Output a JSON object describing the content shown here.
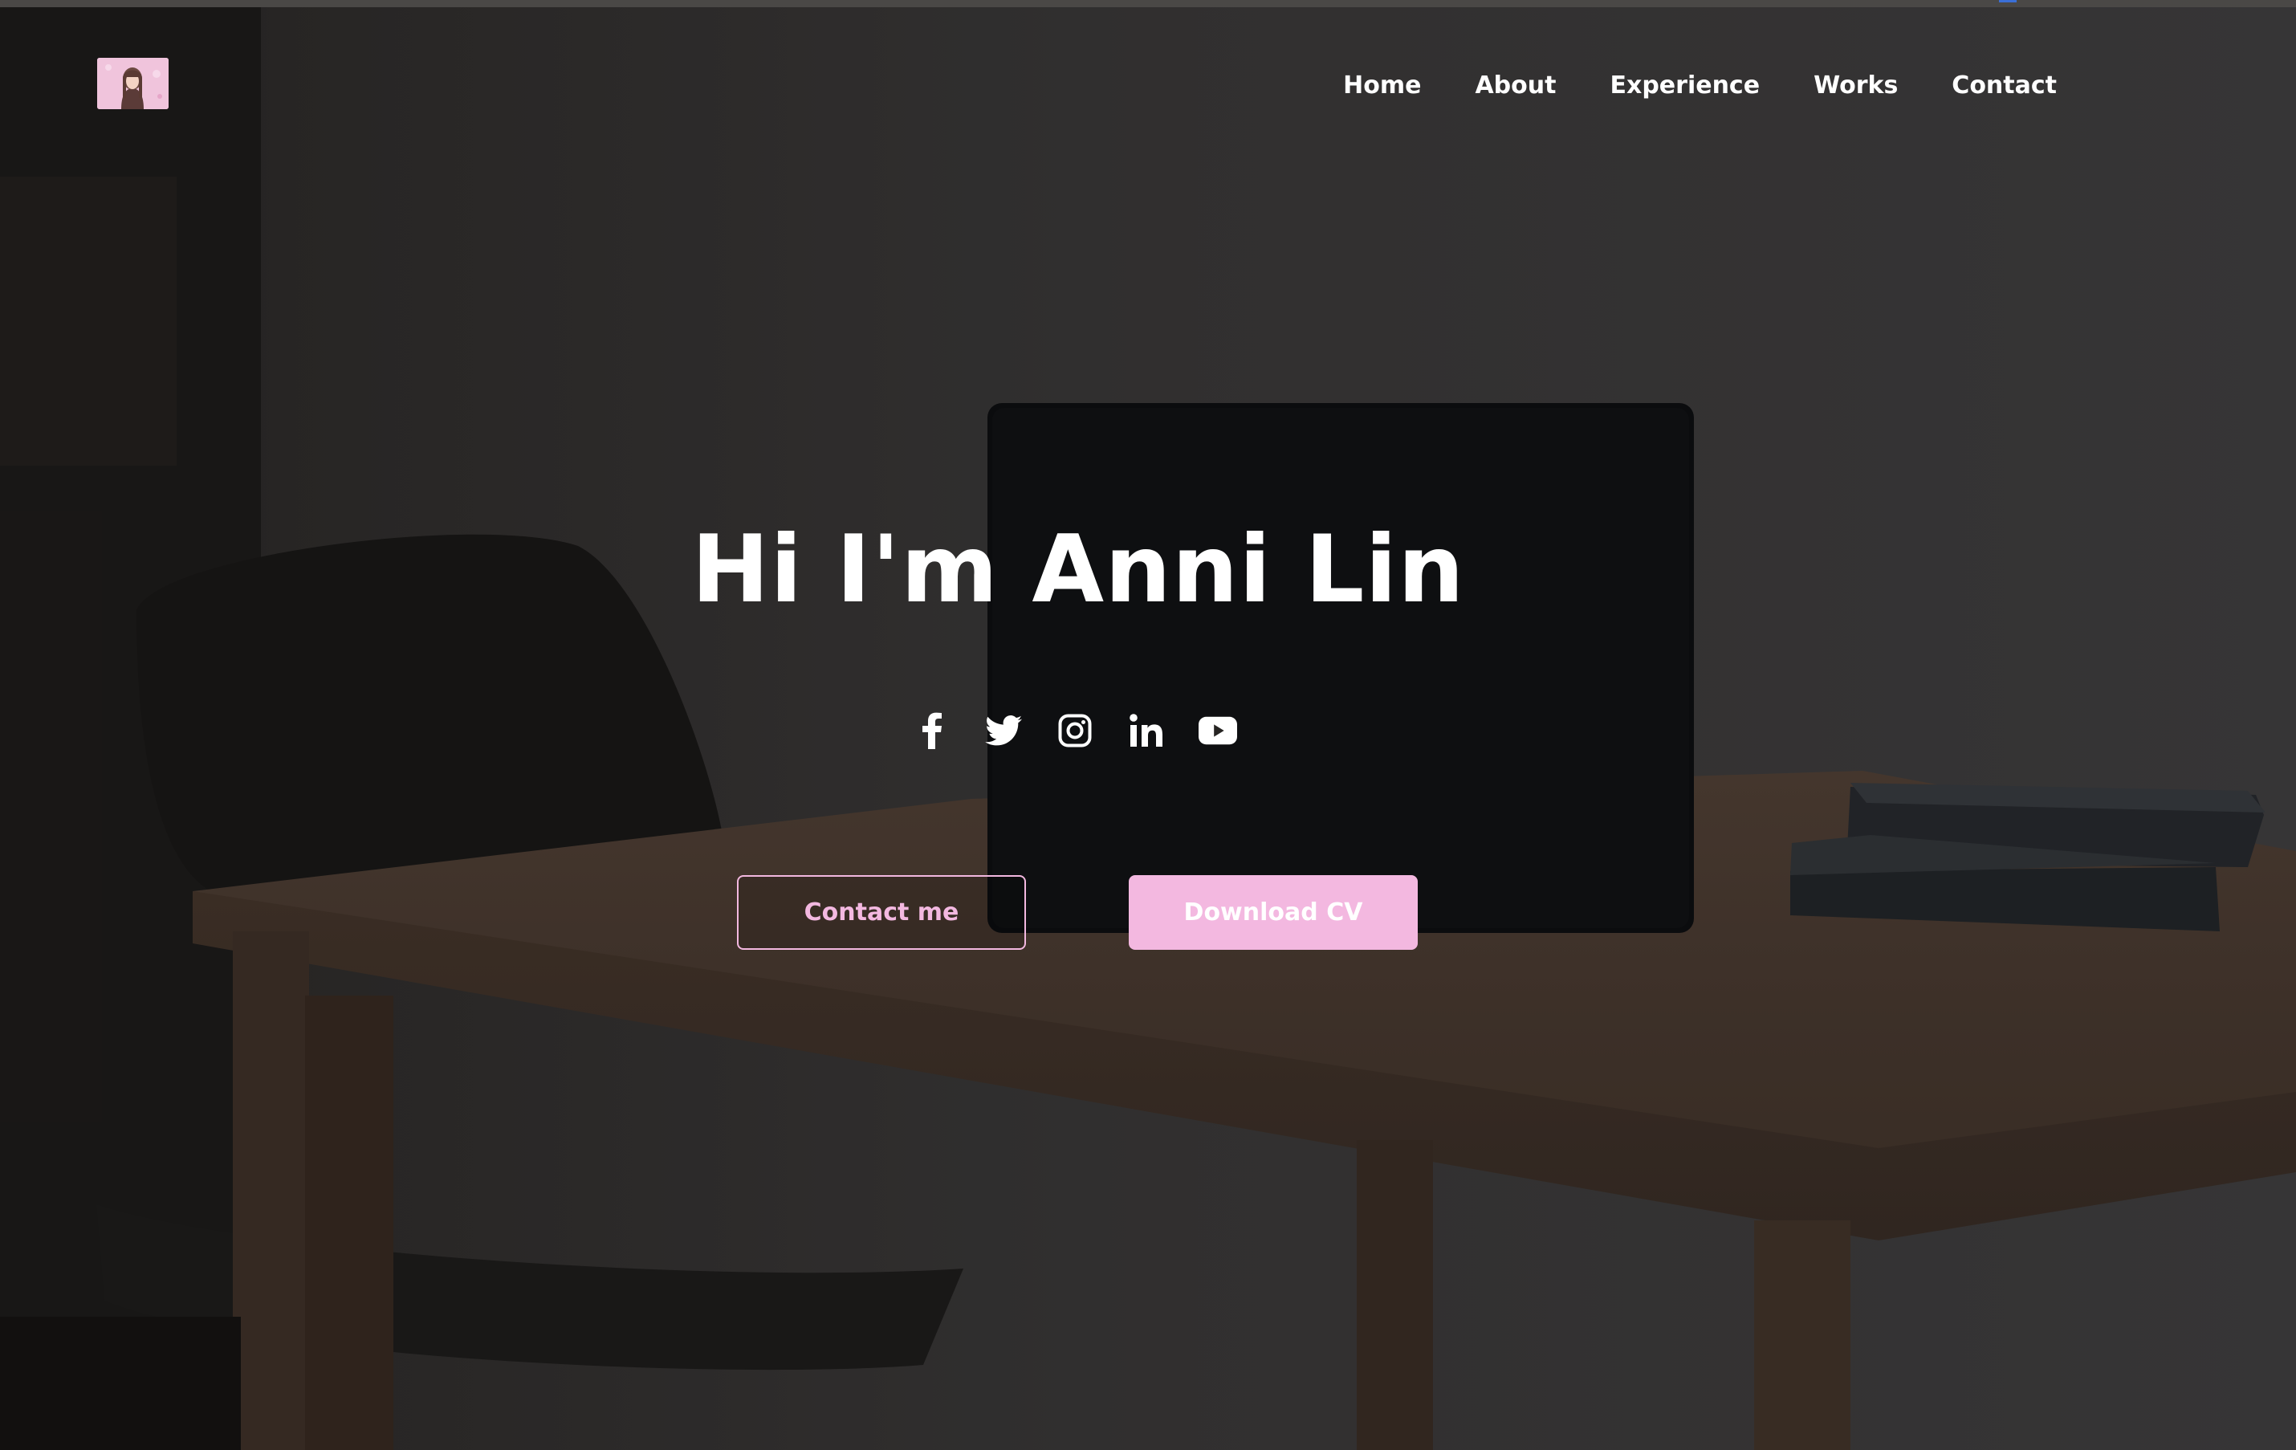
{
  "colors": {
    "accent": "#f3b8e0",
    "text": "#ffffff",
    "background_overlay": "#262422"
  },
  "header": {
    "logo_icon": "avatar-photo-icon",
    "nav": [
      {
        "label": "Home"
      },
      {
        "label": "About"
      },
      {
        "label": "Experience"
      },
      {
        "label": "Works"
      },
      {
        "label": "Contact"
      }
    ]
  },
  "hero": {
    "title": "Hi I'm Anni Lin",
    "socials": [
      {
        "icon": "facebook-icon"
      },
      {
        "icon": "twitter-icon"
      },
      {
        "icon": "instagram-icon"
      },
      {
        "icon": "linkedin-icon"
      },
      {
        "icon": "youtube-icon"
      }
    ],
    "contact_button": "Contact me",
    "cv_button": "Download CV"
  }
}
